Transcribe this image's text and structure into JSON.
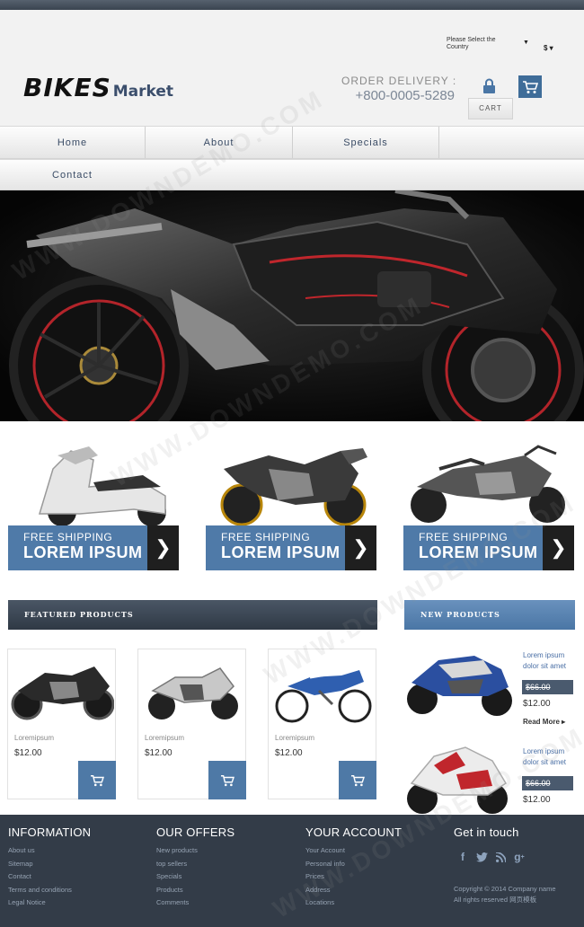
{
  "header": {
    "logo_main": "BIKES",
    "logo_sub": "Market",
    "country_label": "Please Select the Country",
    "currency": "$",
    "order_label": "ORDER DELIVERY :",
    "phone": "+800-0005-5289",
    "cart_label": "CART"
  },
  "nav": {
    "items": [
      "Home",
      "About",
      "Specials",
      "Contact"
    ]
  },
  "promos": [
    {
      "line1": "FREE SHIPPING",
      "line2": "LOREM IPSUM"
    },
    {
      "line1": "FREE SHIPPING",
      "line2": "LOREM IPSUM"
    },
    {
      "line1": "FREE SHIPPING",
      "line2": "LOREM IPSUM"
    }
  ],
  "featured": {
    "title": "FEATURED PRODUCTS",
    "products": [
      {
        "name": "Loremipsum",
        "price": "$12.00"
      },
      {
        "name": "Loremipsum",
        "price": "$12.00"
      },
      {
        "name": "Loremipsum",
        "price": "$12.00"
      }
    ]
  },
  "new_products": {
    "title": "NEW PRODUCTS",
    "items": [
      {
        "title": "Lorem ipsum dolor sit amet",
        "old_price": "$66.00",
        "price": "$12.00",
        "more": "Read More"
      },
      {
        "title": "Lorem ipsum dolor sit amet",
        "old_price": "$66.00",
        "price": "$12.00"
      }
    ]
  },
  "footer": {
    "information": {
      "title": "INFORMATION",
      "links": [
        "About us",
        "Sitemap",
        "Contact",
        "Terms and conditions",
        "Legal Notice"
      ]
    },
    "offers": {
      "title": "OUR OFFERS",
      "links": [
        "New products",
        "top sellers",
        "Specials",
        "Products",
        "Comments"
      ]
    },
    "account": {
      "title": "YOUR ACCOUNT",
      "links": [
        "Your Account",
        "Personal info",
        "Prices",
        "Address",
        "Locations"
      ]
    },
    "touch": {
      "title": "Get in touch",
      "social": [
        "f",
        "twitter",
        "rss",
        "g+"
      ]
    },
    "copyright": "Copyright © 2014 Company name",
    "rights": "All rights reserved 网页模板"
  },
  "watermark": "WWW.DOWNDEMO.COM",
  "colors": {
    "accent": "#4e79a6",
    "dark": "#333c48",
    "hero_bg": "#060606"
  }
}
